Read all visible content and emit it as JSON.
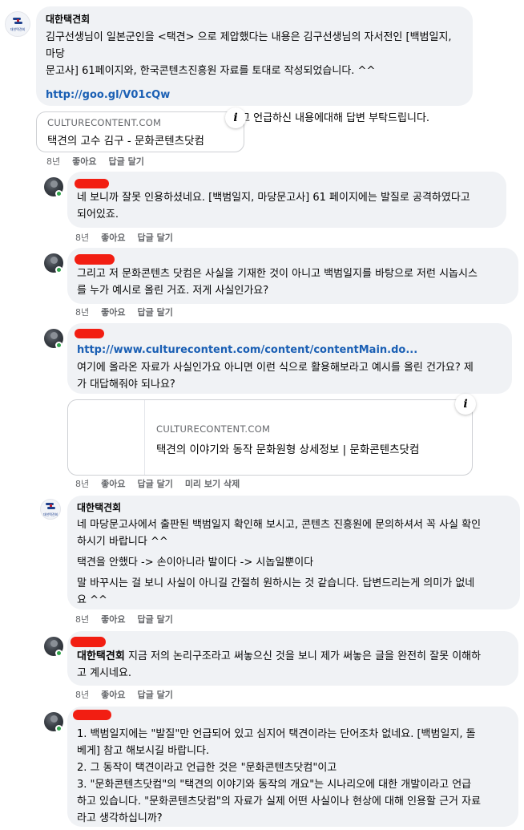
{
  "comments": [
    {
      "author": "대한택견회",
      "avatar_label": "대한택견회",
      "lines": [
        "김구선생님이 일본군인을 <택견> 으로 제압했다는 내용은 김구선생님의 자서전인 [백범일지, 마당\n문고사] 61페이지와, 한국콘텐츠진흥원 자료를 토대로 작성되었습니다. ^^"
      ],
      "link": "http://goo.gl/V01cQw",
      "after": "확인하신 후 '친일파만큼 나쁜 새끼들이다' 라고 언급하신 내용에대해 답변 부탁드립니다.",
      "card": {
        "domain": "CULTURECONTENT.COM",
        "title": "택견의 고수 김구 - 문화콘텐츠닷컴"
      },
      "meta": [
        "8년",
        "좋아요",
        "답글 달기"
      ]
    },
    {
      "text": "네 보니까 잘못 인용하셨네요. [백범일지, 마당문고사] 61 페이지에는 발질로 공격하였다고\n되어있죠.",
      "meta": [
        "8년",
        "좋아요",
        "답글 달기"
      ]
    },
    {
      "text": "그리고 저 문화콘텐츠 닷컴은 사실을 기재한 것이 아니고 백범일지를 바탕으로 저런 시놉시스\n를 누가 예시로 올린 거죠. 저게 사실인가요?",
      "meta": [
        "8년",
        "좋아요",
        "답글 달기"
      ]
    },
    {
      "link": "http://www.culturecontent.com/content/contentMain.do...",
      "text": "여기에 올라온 자료가 사실인가요 아니면 이런 식으로 활용해보라고 예시를 올린 건가요? 제\n가 대답해줘야 되나요?",
      "card": {
        "domain": "CULTURECONTENT.COM",
        "title": "택견의 이야기와 동작 문화원형 상세정보 | 문화콘텐츠닷컴"
      },
      "meta": [
        "8년",
        "좋아요",
        "답글 달기",
        "미리 보기 삭제"
      ]
    },
    {
      "author": "대한택견회",
      "paragraphs": [
        "네 마당문고사에서 출판된 백범일지 확인해 보시고, 콘텐츠 진흥원에 문의하셔서 꼭 사실 확인\n하시기 바랍니다 ^^",
        "택견을 안했다 -> 손이아니라 발이다 -> 시놉일뿐이다",
        "말 바꾸시는 걸 보니 사실이 아니길 간절히 원하시는 것 같습니다. 답변드리는게 의미가 없네\n요 ^^"
      ],
      "meta": [
        "8년",
        "좋아요",
        "답글 달기"
      ]
    },
    {
      "mention": "대한택견회",
      "text": " 지금 저의 논리구조라고 써놓으신 것을 보니 제가 써놓은 글을 완전히 잘못 이해하\n고 계시네요.",
      "meta": [
        "8년",
        "좋아요",
        "답글 달기"
      ]
    },
    {
      "paragraph": "1. 백범일지에는 \"발질\"만 언급되어 있고 심지어 택견이라는 단어조차 없네요. [백범일지, 돌\n베게] 참고 해보시길 바랍니다.\n2. 그 동작이 택견이라고 언급한 것은 \"문화콘텐츠닷컴\"이고\n3. \"문화콘텐츠닷컴\"의 \"택견의 이야기와 동작의 개요\"는 시나리오에 대한 개발이라고 언급\n하고 있습니다. \"문화콘텐츠닷컴\"의 자료가 실제 어떤 사실이나 현상에 대해 인용할 근거 자료\n라고 생각하십니까?"
    }
  ],
  "colors": {
    "bubble": "#f0f2f5",
    "link": "#1a5fb4",
    "meta": "#65676b",
    "online": "#31a24c",
    "redact": "#f21e12"
  },
  "icons": {
    "info": "i"
  }
}
